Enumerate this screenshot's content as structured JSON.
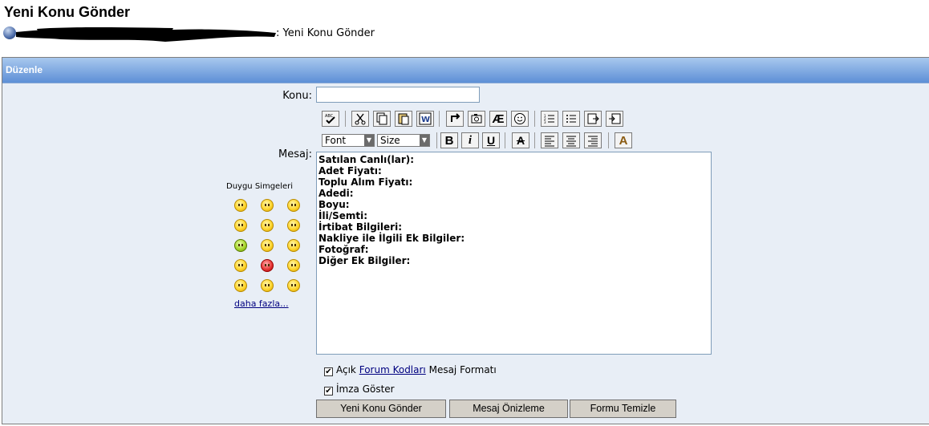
{
  "page": {
    "title": "Yeni Konu Gönder"
  },
  "breadcrumb": {
    "current": ": Yeni Konu Gönder"
  },
  "panel": {
    "title": "Düzenle"
  },
  "form": {
    "subject_label": "Konu:",
    "subject_value": "",
    "message_label": "Mesaj:",
    "message_lines": [
      "Satılan Canlı(lar):",
      "Adet Fiyatı:",
      "Toplu Alım Fiyatı:",
      "Adedi:",
      "Boyu:",
      "İli/Semti:",
      "İrtibat Bilgileri:",
      "Nakliye ile İlgili Ek Bilgiler:",
      "Fotoğraf:",
      "Diğer Ek Bilgiler:"
    ]
  },
  "toolbar": {
    "font_select": "Font",
    "size_select": "Size",
    "bold": "B",
    "italic": "i",
    "underline": "U",
    "strike": "A",
    "color": "A",
    "special_char": "Æ"
  },
  "smilies": {
    "title": "Duygu Simgeleri",
    "more": "daha fazla..."
  },
  "options": {
    "forum_codes_pre": "Açık",
    "forum_codes_link": "Forum Kodları",
    "forum_codes_post": "Mesaj Formatı",
    "signature": "İmza Göster"
  },
  "buttons": {
    "submit": "Yeni Konu Gönder",
    "preview": "Mesaj Önizleme",
    "reset": "Formu Temizle"
  },
  "colors": {
    "header_top": "#a8c8ee",
    "header_bottom": "#5d8fd6",
    "panel_bg": "#e8eef6",
    "link": "#000080"
  }
}
